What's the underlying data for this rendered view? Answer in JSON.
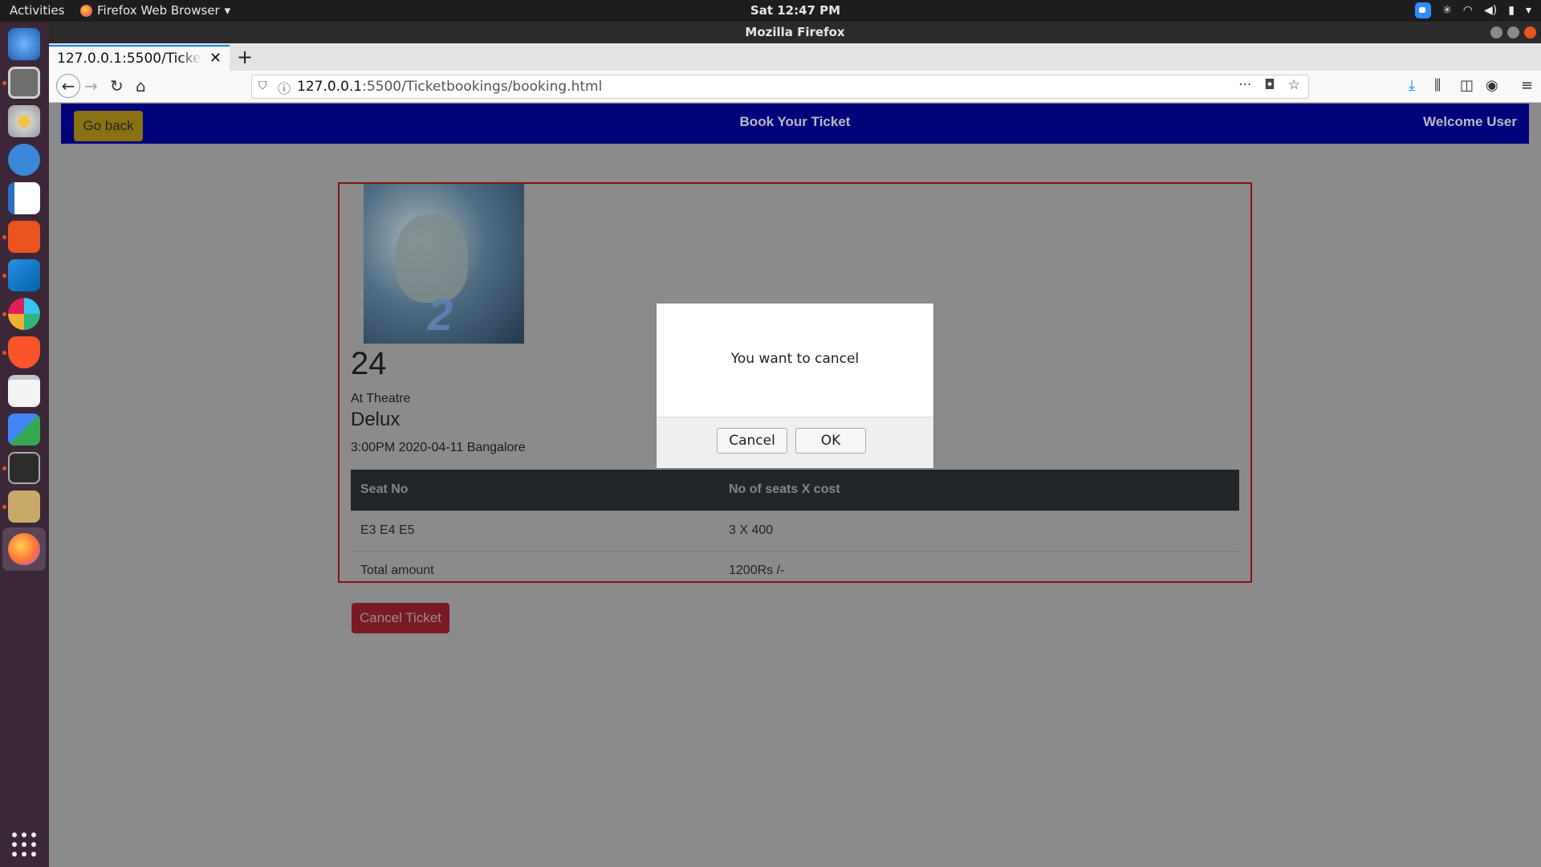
{
  "system": {
    "activities": "Activities",
    "app_menu": "Firefox Web Browser",
    "clock": "Sat 12:47 PM"
  },
  "window": {
    "title": "Mozilla Firefox"
  },
  "browser": {
    "tab_title": "127.0.0.1:5500/Ticketbookings/booking.html",
    "url_host": "127.0.0.1",
    "url_rest": ":5500/Ticketbookings/booking.html"
  },
  "app": {
    "go_back": "Go back",
    "header_title": "Book Your Ticket",
    "welcome": "Welcome User"
  },
  "booking": {
    "movie_title": "24",
    "at_theatre": "At Theatre",
    "theatre_name": "Delux",
    "showtime": "3:00PM 2020-04-11 Bangalore",
    "table_headers": [
      "Seat No",
      "No of seats X cost"
    ],
    "rows": [
      [
        "E3 E4 E5",
        "3 X 400"
      ],
      [
        "Total amount",
        "1200Rs /-"
      ]
    ],
    "cancel_button": "Cancel Ticket"
  },
  "dialog": {
    "message": "You want to cancel",
    "cancel_label": "Cancel",
    "ok_label": "OK"
  },
  "colors": {
    "app_nav_bg": "#00037a",
    "go_back_bg": "#8a7213",
    "card_border": "#861313",
    "cancel_ticket_bg": "#7a1a25",
    "table_header_bg": "#232629"
  }
}
